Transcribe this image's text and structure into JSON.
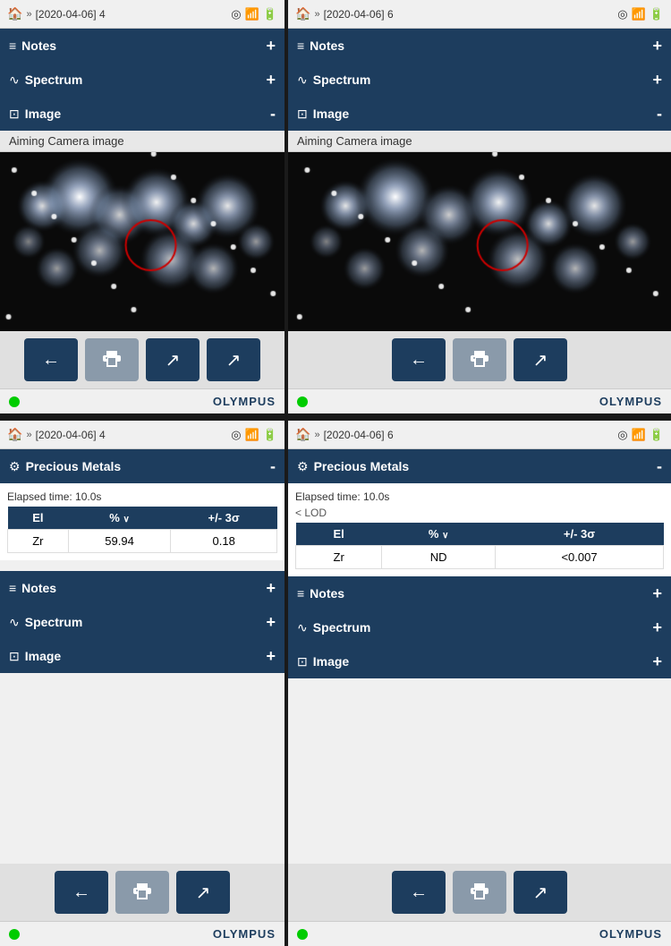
{
  "panel1": {
    "statusbar": {
      "breadcrumb": "[2020-04-06] 4"
    },
    "sections": {
      "notes": {
        "label": "Notes",
        "icon": "≡",
        "toggle": "+"
      },
      "spectrum": {
        "label": "Spectrum",
        "icon": "∿",
        "toggle": "+"
      },
      "image": {
        "label": "Image",
        "icon": "⊡",
        "toggle": "-"
      }
    },
    "image": {
      "caption": "Aiming Camera image"
    },
    "footer": {
      "brand": "OLYMPUS"
    },
    "buttons": {
      "back": "←",
      "print": "🖨",
      "expand1": "↗",
      "expand2": "↗"
    }
  },
  "panel2": {
    "statusbar": {
      "breadcrumb": "[2020-04-06] 6"
    },
    "sections": {
      "notes": {
        "label": "Notes",
        "icon": "≡",
        "toggle": "+"
      },
      "spectrum": {
        "label": "Spectrum",
        "icon": "∿",
        "toggle": "+"
      },
      "image": {
        "label": "Image",
        "icon": "⊡",
        "toggle": "-"
      }
    },
    "image": {
      "caption": "Aiming Camera image"
    },
    "footer": {
      "brand": "OLYMPUS"
    },
    "buttons": {
      "back": "←",
      "print": "🖨",
      "expand1": "↗"
    }
  },
  "panel3": {
    "statusbar": {
      "breadcrumb": "[2020-04-06] 4"
    },
    "precious_metals": {
      "label": "Precious Metals",
      "icon": "⚙",
      "toggle": "-",
      "elapsed": "Elapsed time: 10.0s",
      "table": {
        "headers": [
          "El",
          "%",
          "+/- 3σ"
        ],
        "rows": [
          [
            "Zr",
            "59.94",
            "0.18"
          ]
        ]
      }
    },
    "sections": {
      "notes": {
        "label": "Notes",
        "icon": "≡",
        "toggle": "+"
      },
      "spectrum": {
        "label": "Spectrum",
        "icon": "∿",
        "toggle": "+"
      },
      "image": {
        "label": "Image",
        "icon": "⊡",
        "toggle": "+"
      }
    },
    "footer": {
      "brand": "OLYMPUS"
    },
    "buttons": {
      "back": "←",
      "print": "🖨",
      "expand1": "↗"
    }
  },
  "panel4": {
    "statusbar": {
      "breadcrumb": "[2020-04-06] 6"
    },
    "precious_metals": {
      "label": "Precious Metals",
      "icon": "⚙",
      "toggle": "-",
      "elapsed": "Elapsed time: 10.0s",
      "lod": "< LOD",
      "table": {
        "headers": [
          "El",
          "%",
          "+/- 3σ"
        ],
        "rows": [
          [
            "Zr",
            "ND",
            "<0.007"
          ]
        ]
      }
    },
    "sections": {
      "notes": {
        "label": "Notes",
        "icon": "≡",
        "toggle": "+"
      },
      "spectrum": {
        "label": "Spectrum",
        "icon": "∿",
        "toggle": "+"
      },
      "image": {
        "label": "Image",
        "icon": "⊡",
        "toggle": "+"
      }
    },
    "footer": {
      "brand": "OLYMPUS"
    },
    "buttons": {
      "back": "←",
      "print": "🖨",
      "expand1": "↗"
    }
  }
}
